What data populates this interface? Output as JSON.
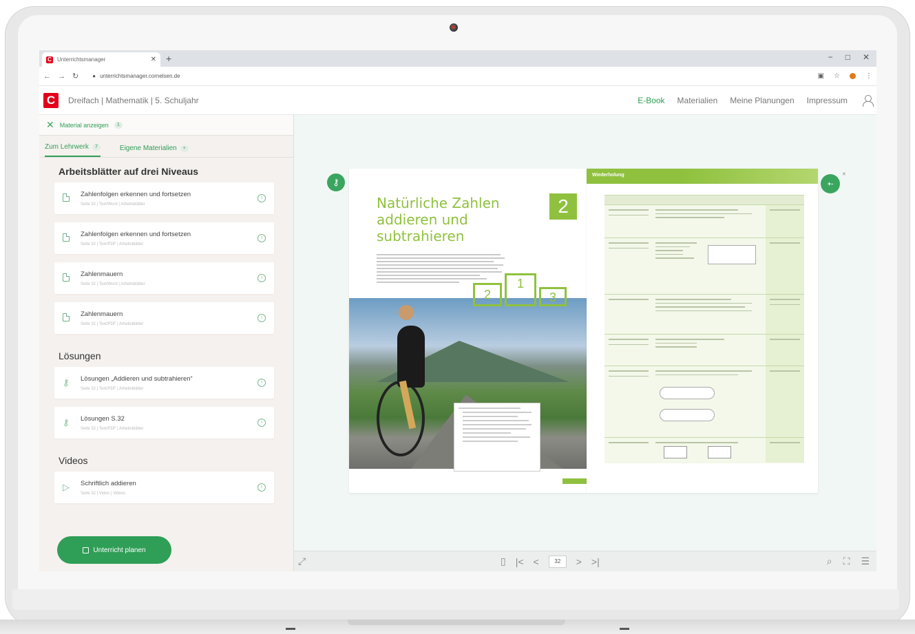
{
  "browser": {
    "tab_title": "Unterrichtsmanager",
    "url": "unterrichtsmanager.cornelsen.de",
    "controls": [
      "−",
      "□",
      "✕"
    ]
  },
  "app": {
    "logo_letter": "C",
    "title": "Dreifach | Mathematik | 5. Schuljahr",
    "nav": [
      "E-Book",
      "Materialien",
      "Meine Planungen",
      "Impressum"
    ],
    "active_nav": "E-Book"
  },
  "sidebar": {
    "material_toggle": "Material anzeigen",
    "material_count": "1",
    "tabs": [
      {
        "label": "Zum Lehrwerk",
        "count": "7"
      },
      {
        "label": "Eigene Materialien",
        "count": "+"
      }
    ],
    "sections": [
      {
        "heading": "Arbeitsblätter auf drei Niveaus",
        "items": [
          {
            "title": "Zahlenfolgen erkennen und fortsetzen",
            "meta": "Seite 32  |  Text/Word  |  Arbeitsblätter"
          },
          {
            "title": "Zahlenfolgen erkennen und fortsetzen",
            "meta": "Seite 32  |  Text/PDF  |  Arbeitsblätter"
          },
          {
            "title": "Zahlenmauern",
            "meta": "Seite 32  |  Text/Word  |  Arbeitsblätter"
          },
          {
            "title": "Zahlenmauern",
            "meta": "Seite 32  |  Text/PDF  |  Arbeitsblätter"
          }
        ]
      },
      {
        "heading": "Lösungen",
        "items": [
          {
            "title": "Lösungen „Addieren und subtrahieren“",
            "meta": "Seite 32  |  Text/PDF  |  Arbeitsblätter"
          },
          {
            "title": "Lösungen S.32",
            "meta": "Seite 32  |  Text/PDF  |  Arbeitsblätter"
          }
        ]
      },
      {
        "heading": "Videos",
        "items": [
          {
            "title": "Schriftlich addieren",
            "meta": "Seite 32  |  Video  |  Videos"
          }
        ]
      }
    ],
    "plan_button": "Unterricht planen"
  },
  "ebook": {
    "chapter_title_lines": [
      "Natürliche Zahlen",
      "addieren und",
      "subtrahieren"
    ],
    "chapter_number": "2",
    "podium": [
      "2",
      "1",
      "3"
    ],
    "review_header": "Wiederholung",
    "tools_badge": "+-"
  },
  "viewer_bar": {
    "page": "32"
  },
  "colors": {
    "brand_red": "#e3001b",
    "accent_green": "#2f9e57",
    "book_green": "#8fc13e"
  }
}
